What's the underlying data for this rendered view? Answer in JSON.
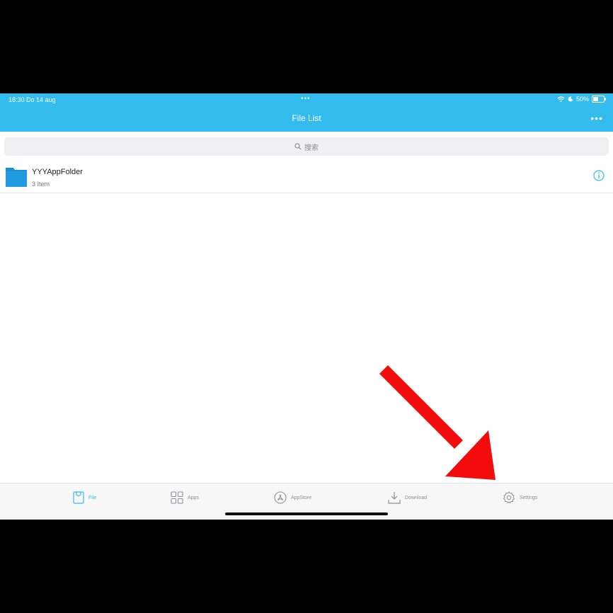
{
  "status_bar": {
    "time": "18:30  Do 14 aug",
    "dots": "•••",
    "battery": "50%"
  },
  "header": {
    "title": "File List",
    "more": "•••"
  },
  "search": {
    "placeholder": "搜索"
  },
  "files": [
    {
      "name": "YYYAppFolder",
      "subtitle": "3 Item"
    }
  ],
  "tabs": [
    {
      "label": "File",
      "active": true
    },
    {
      "label": "Apps",
      "active": false
    },
    {
      "label": "AppStore",
      "active": false
    },
    {
      "label": "Download",
      "active": false
    },
    {
      "label": "Settings",
      "active": false
    }
  ],
  "colors": {
    "accent": "#34bcee",
    "folder": "#1a8fd6",
    "annotation_arrow": "#f20c0c"
  }
}
